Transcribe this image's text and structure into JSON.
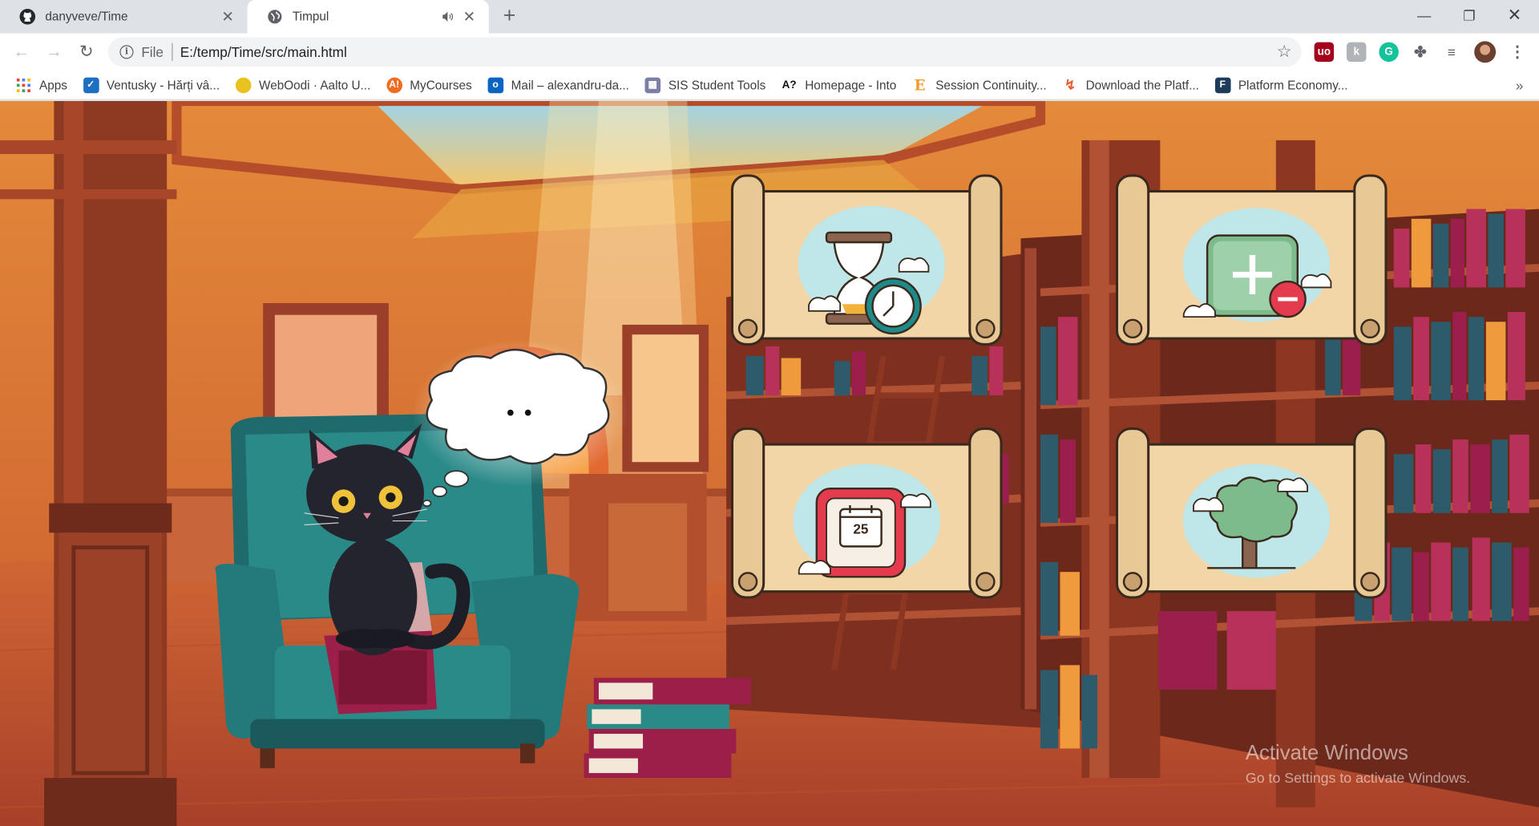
{
  "tabs": [
    {
      "title": "danyveve/Time",
      "icon": "github-icon",
      "active": false
    },
    {
      "title": "Timpul",
      "icon": "globe-icon",
      "active": true
    }
  ],
  "address": {
    "scheme": "File",
    "url": "E:/temp/Time/src/main.html"
  },
  "bookmarks": [
    {
      "label": "Apps",
      "icon": "apps-grid-icon",
      "color": "#4285f4"
    },
    {
      "label": "Ventusky - Hărți vâ...",
      "icon": "ventusky-icon",
      "color": "#1c6fc2"
    },
    {
      "label": "WebOodi · Aalto U...",
      "icon": "weboodi-icon",
      "color": "#e8c21d"
    },
    {
      "label": "MyCourses",
      "icon": "mycourses-icon",
      "color": "#f26b21"
    },
    {
      "label": "Mail – alexandru-da...",
      "icon": "outlook-icon",
      "color": "#0a64c2"
    },
    {
      "label": "SIS Student Tools",
      "icon": "sis-icon",
      "color": "#7b7fa5"
    },
    {
      "label": "Homepage - Into",
      "icon": "into-icon",
      "color": "#111111"
    },
    {
      "label": "Session Continuity...",
      "icon": "e-icon",
      "color": "#f39a2e"
    },
    {
      "label": "Download the Platf...",
      "icon": "download-icon",
      "color": "#e2612f"
    },
    {
      "label": "Platform Economy...",
      "icon": "f-icon",
      "color": "#1d3b5a"
    }
  ],
  "speech": {
    "text": "• •"
  },
  "cards": [
    {
      "name": "hourglass-clock",
      "icon": "hourglass-clock-icon"
    },
    {
      "name": "plus-minus",
      "icon": "plus-minus-icon"
    },
    {
      "name": "calendar",
      "icon": "calendar-icon",
      "day": "25"
    },
    {
      "name": "tree",
      "icon": "tree-icon"
    }
  ],
  "watermark": {
    "line1": "Activate Windows",
    "line2": "Go to Settings to activate Windows."
  }
}
